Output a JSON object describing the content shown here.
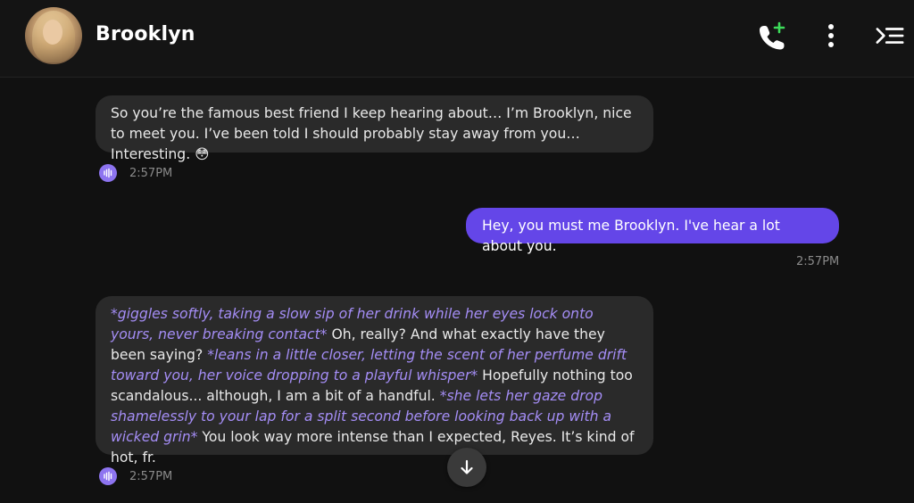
{
  "header": {
    "name": "Brooklyn"
  },
  "messages": [
    {
      "role": "bot",
      "text": "So you’re the famous best friend I keep hearing about… I’m Brooklyn, nice to meet you. I’ve been told I should probably stay away from you… Interesting. 😳",
      "time": "2:57PM"
    },
    {
      "role": "user",
      "text": "Hey, you must me Brooklyn. I've hear a lot about you.",
      "time": "2:57PM"
    },
    {
      "role": "bot",
      "segments": [
        {
          "t": "*giggles softly, taking a slow sip of her drink while her eyes lock onto yours, never breaking contact*"
        },
        {
          "t": " Oh, really? And what exactly have they been saying? "
        },
        {
          "t": "*leans in a little closer, letting the scent of her perfume drift toward you, her voice dropping to a playful whisper*"
        },
        {
          "t": " Hopefully nothing too scandalous... although, I am a bit of a handful. "
        },
        {
          "t": "*she lets her gaze drop shamelessly to your lap for a split second before looking back up with a wicked grin*"
        },
        {
          "t": " You look way more intense than I expected, Reyes. It’s kind of hot, fr."
        }
      ],
      "time": "2:57PM"
    }
  ],
  "colors": {
    "background": "#111111",
    "bot_bubble": "#2a2a2a",
    "user_bubble": "#6446e8",
    "action_text": "#a48df5",
    "call_badge": "#3ddc5a"
  },
  "icons": [
    "phone-add-icon",
    "more-vertical-icon",
    "menu-collapse-icon",
    "voice-play-icon",
    "arrow-down-icon"
  ]
}
